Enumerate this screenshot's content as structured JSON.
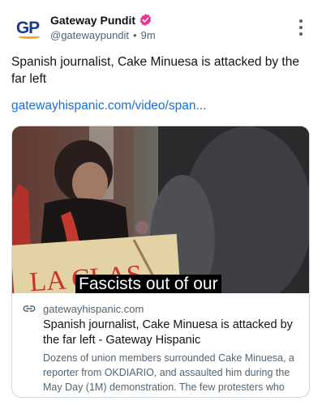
{
  "post": {
    "author": {
      "display_name": "Gateway Pundit",
      "avatar_text": "GP",
      "handle": "@gatewaypundit",
      "timestamp": "9m",
      "verified_color": "#e8368f"
    },
    "text": "Spanish journalist, Cake Minuesa is attacked by the far left",
    "link_text": "gatewayhispanic.com/video/span...",
    "more_icon": "more-vertical-icon"
  },
  "card": {
    "image_caption": "Fascists out of our",
    "sign_text": "LA CLAS",
    "domain": "gatewayhispanic.com",
    "title": "Spanish journalist, Cake Minuesa is attacked by the far left - Gateway Hispanic",
    "description": "Dozens of union members surrounded Cake Minuesa, a reporter from OKDIARIO, and assaulted him during the May Day (1M) demonstration. The few protesters who",
    "link_icon": "link-icon"
  },
  "colors": {
    "accent_link": "#1d6fd6",
    "muted_text": "#536471",
    "brand_blue": "#1d3a8a",
    "brand_orange": "#f2a51c"
  }
}
